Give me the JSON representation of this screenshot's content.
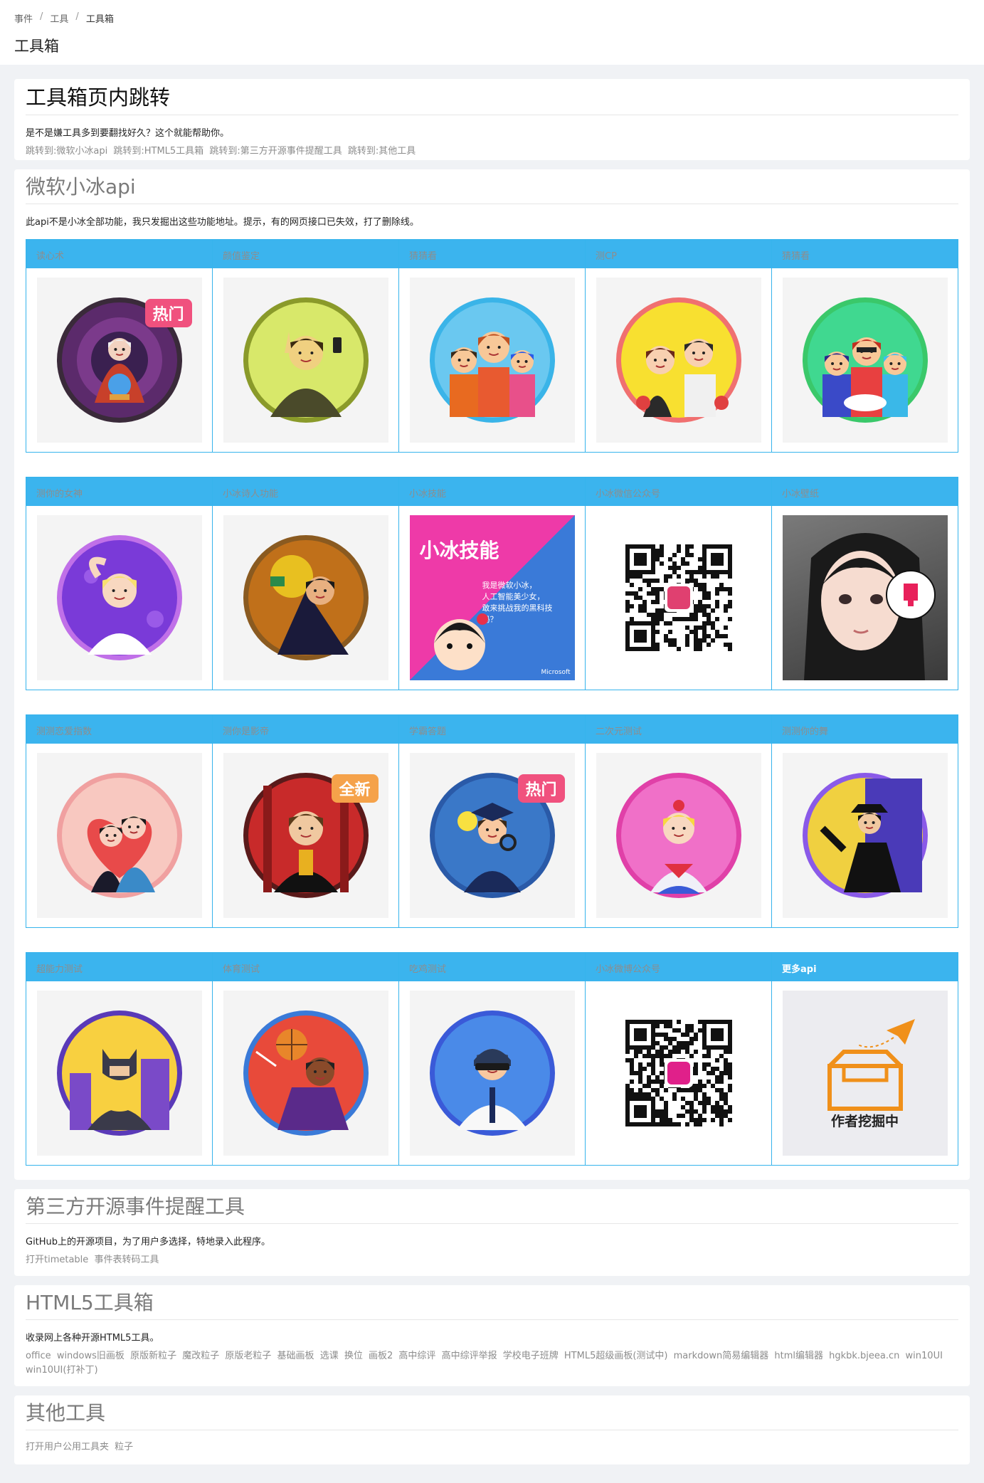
{
  "breadcrumb": [
    "事件",
    "工具",
    "工具箱"
  ],
  "page_title": "工具箱",
  "jump": {
    "title": "工具箱页内跳转",
    "desc": "是不是嫌工具多到要翻找好久？这个就能帮助你。",
    "links": [
      "跳转到:微软小冰api",
      "跳转到:HTML5工具箱",
      "跳转到:第三方开源事件提醒工具",
      "跳转到:其他工具"
    ]
  },
  "xiaoice": {
    "title": "微软小冰api",
    "desc": "此api不是小冰全部功能，我只发掘出这些功能地址。提示，有的网页接口已失效，打了删除线。",
    "rows": [
      [
        {
          "label": "读心术",
          "art": "fortune",
          "badge": "热门"
        },
        {
          "label": "颜值鉴定",
          "art": "mona"
        },
        {
          "label": "猜猜看",
          "art": "family"
        },
        {
          "label": "测CP",
          "art": "couple"
        },
        {
          "label": "猜猜看",
          "art": "party"
        }
      ],
      [
        {
          "label": "测你的女神",
          "art": "marilyn"
        },
        {
          "label": "小冰诗人功能",
          "art": "poet"
        },
        {
          "label": "小冰技能",
          "art": "skill"
        },
        {
          "label": "小冰微信公众号",
          "art": "qr1"
        },
        {
          "label": "小冰壁纸",
          "art": "girl"
        }
      ],
      [
        {
          "label": "测测恋爱指数",
          "art": "lovers"
        },
        {
          "label": "测你是影帝",
          "art": "oscar",
          "badge": "全新"
        },
        {
          "label": "学霸答题",
          "art": "scholar",
          "badge": "热门"
        },
        {
          "label": "二次元测试",
          "art": "sailor"
        },
        {
          "label": "测测你的舞",
          "art": "dancer"
        }
      ],
      [
        {
          "label": "超能力测试",
          "art": "batman"
        },
        {
          "label": "体育测试",
          "art": "basketball"
        },
        {
          "label": "吃鸡测试",
          "art": "pubg"
        },
        {
          "label": "小冰微博公众号",
          "art": "qr2"
        },
        {
          "label": "更多api",
          "art": "more",
          "more": true
        }
      ]
    ],
    "skill_poster": {
      "title": "小冰技能",
      "bubble": "我是微软小冰，\n人工智能美少女，\n敢来挑战我的黑科技吗？",
      "brand": "Microsoft"
    },
    "more_text": "作者挖掘中"
  },
  "third": {
    "title": "第三方开源事件提醒工具",
    "desc": "GitHub上的开源项目，为了用户多选择，特地录入此程序。",
    "links": [
      "打开timetable",
      "事件表转码工具"
    ]
  },
  "html5": {
    "title": "HTML5工具箱",
    "desc": "收录网上各种开源HTML5工具。",
    "links": [
      "office",
      "windows旧画板",
      "原版新粒子",
      "魔改粒子",
      "原版老粒子",
      "基础画板",
      "选课",
      "换位",
      "画板2",
      "高中综评",
      "高中综评举报",
      "学校电子班牌",
      "HTML5超级画板(测试中)",
      "markdown简易编辑器",
      "html编辑器",
      "hgkbk.bjeea.cn",
      "win10UI",
      "win10UI(打补丁)"
    ]
  },
  "other": {
    "title": "其他工具",
    "links": [
      "打开用户公用工具夹",
      "粒子"
    ]
  },
  "colors": {
    "accent": "#3bb4ee",
    "hot": "#f0517e",
    "new": "#f5a24a"
  }
}
